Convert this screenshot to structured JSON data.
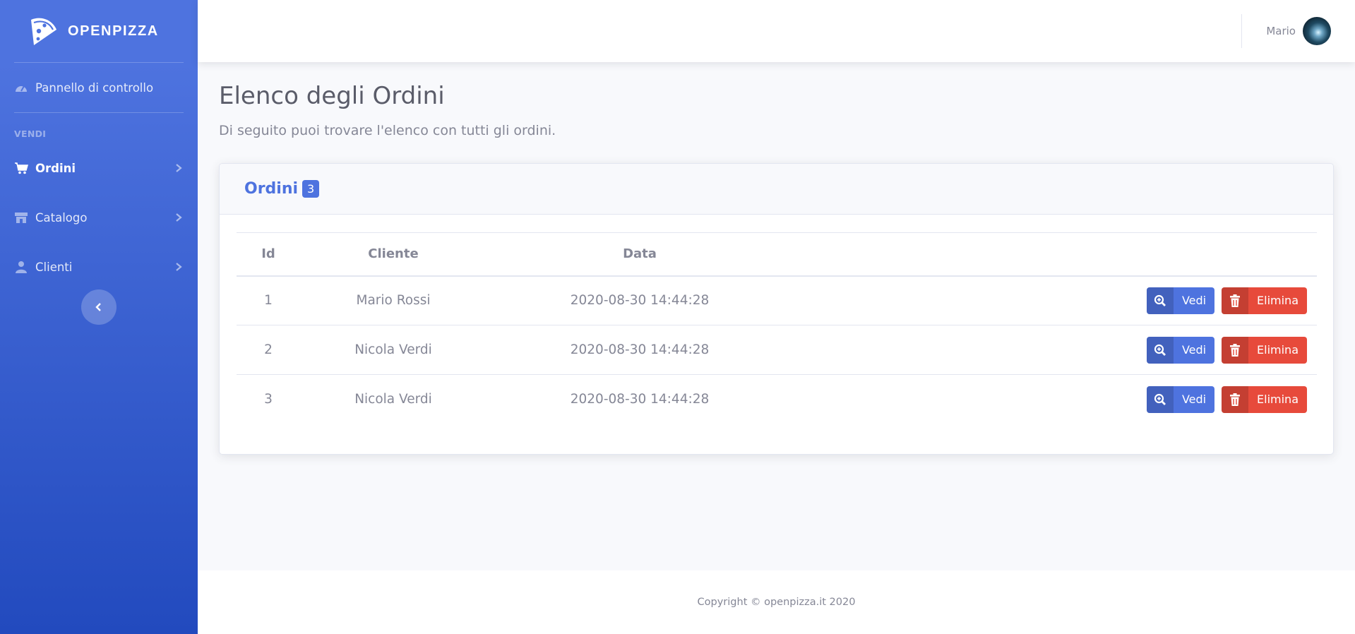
{
  "brand": {
    "name": "OPENPIZZA",
    "logo_icon": "pizza-slice-icon"
  },
  "sidebar": {
    "dashboard": {
      "label": "Pannello di controllo",
      "icon": "gauge-icon"
    },
    "section_heading": "VENDI",
    "items": [
      {
        "label": "Ordini",
        "icon": "shopping-cart-icon",
        "active": true
      },
      {
        "label": "Catalogo",
        "icon": "store-icon",
        "active": false
      },
      {
        "label": "Clienti",
        "icon": "user-icon",
        "active": false
      }
    ],
    "toggle_icon": "chevron-left-icon"
  },
  "topbar": {
    "user_name": "Mario"
  },
  "page": {
    "title": "Elenco degli Ordini",
    "subtitle": "Di seguito puoi trovare l'elenco con tutti gli ordini."
  },
  "orders_card": {
    "title": "Ordini",
    "count": "3",
    "columns": [
      "Id",
      "Cliente",
      "Data",
      ""
    ],
    "rows": [
      {
        "id": "1",
        "cliente": "Mario Rossi",
        "data": "2020-08-30 14:44:28"
      },
      {
        "id": "2",
        "cliente": "Nicola Verdi",
        "data": "2020-08-30 14:44:28"
      },
      {
        "id": "3",
        "cliente": "Nicola Verdi",
        "data": "2020-08-30 14:44:28"
      }
    ],
    "view_label": "Vedi",
    "delete_label": "Elimina"
  },
  "footer": {
    "text": "Copyright © openpizza.it 2020"
  },
  "colors": {
    "primary": "#4e73df",
    "danger": "#e74a3b",
    "text": "#858796",
    "title": "#5a5c69"
  }
}
